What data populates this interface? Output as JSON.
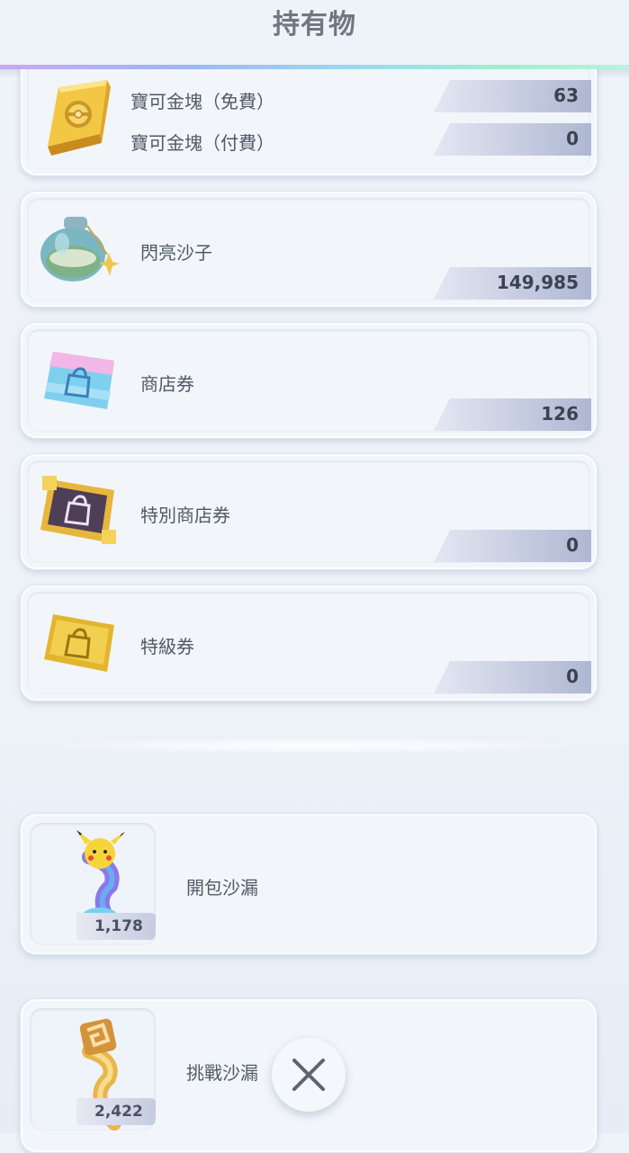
{
  "header": {
    "title": "持有物"
  },
  "gold": {
    "free_label": "寶可金塊（免費）",
    "free_value": "63",
    "paid_label": "寶可金塊（付費）",
    "paid_value": "0"
  },
  "items": [
    {
      "label": "閃亮沙子",
      "value": "149,985"
    },
    {
      "label": "商店券",
      "value": "126"
    },
    {
      "label": "特別商店券",
      "value": "0"
    },
    {
      "label": "特級券",
      "value": "0"
    }
  ],
  "hourglasses": [
    {
      "label": "開包沙漏",
      "count": "1,178"
    },
    {
      "label": "挑戰沙漏",
      "count": "2,422"
    }
  ],
  "icons": {
    "gold": "gold-bar-icon",
    "sand": "shiny-sand-bottle-icon",
    "ticket": "shop-ticket-icon",
    "special_ticket": "special-shop-ticket-icon",
    "premium_ticket": "premium-ticket-icon",
    "pack_hourglass": "pack-hourglass-icon",
    "battle_hourglass": "challenge-hourglass-icon",
    "close": "close-icon"
  }
}
